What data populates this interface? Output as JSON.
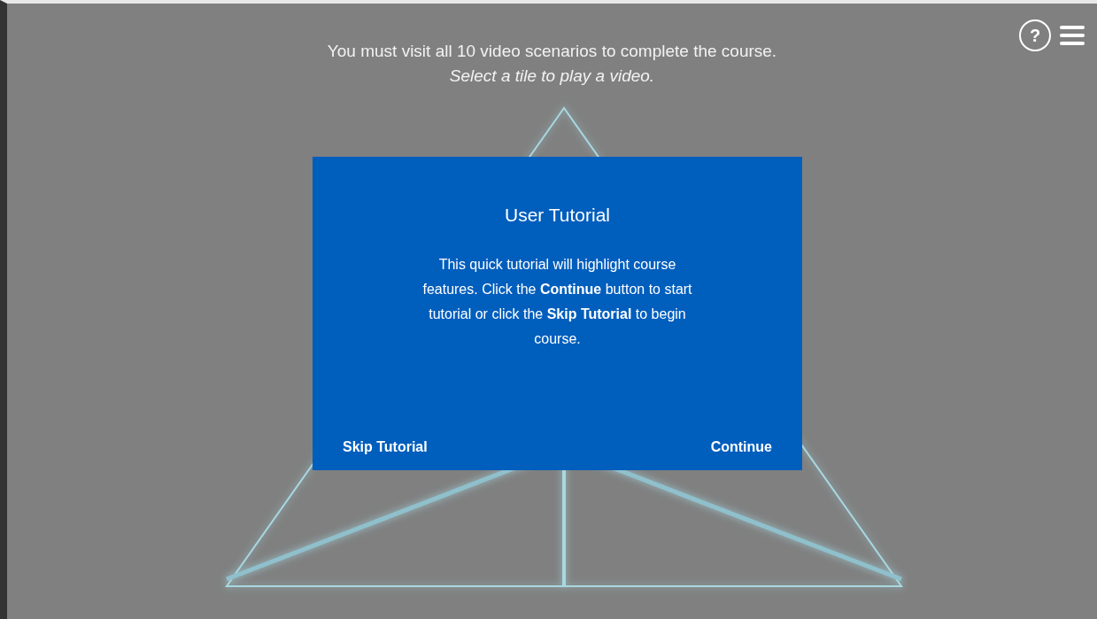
{
  "header": {
    "instruction": "You must visit all 10 video scenarios to complete the course.",
    "hint": "Select a tile to play a video."
  },
  "toolbar": {
    "help": "?"
  },
  "dialog": {
    "title": "User Tutorial",
    "body": "This quick tutorial will highlight course features. Click the **Continue** button to start tutorial or click the **Skip Tutorial** to begin course.",
    "buttons": [
      "Skip Tutorial",
      "Continue"
    ]
  }
}
